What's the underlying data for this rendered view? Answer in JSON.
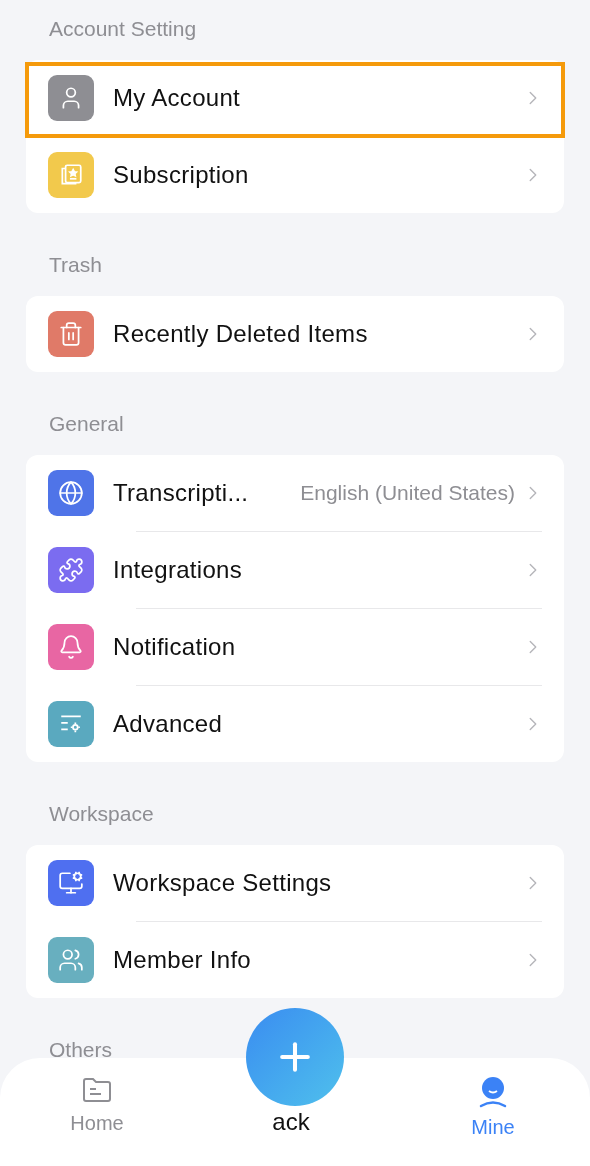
{
  "sections": [
    {
      "title": "Account Setting",
      "items": [
        {
          "label": "My Account",
          "color": "#8e8e93",
          "highlighted": true
        },
        {
          "label": "Subscription",
          "color": "#f2c94c",
          "highlighted": false
        }
      ]
    },
    {
      "title": "Trash",
      "items": [
        {
          "label": "Recently Deleted Items",
          "color": "#e07a68",
          "highlighted": false
        }
      ]
    },
    {
      "title": "General",
      "items": [
        {
          "label": "Transcripti...",
          "value": "English (United States)",
          "color": "#4f74e8",
          "highlighted": false
        },
        {
          "label": "Integrations",
          "color": "#7b6cf0",
          "highlighted": false
        },
        {
          "label": "Notification",
          "color": "#e866a3",
          "highlighted": false
        },
        {
          "label": "Advanced",
          "color": "#5aa9bf",
          "highlighted": false
        }
      ]
    },
    {
      "title": "Workspace",
      "items": [
        {
          "label": "Workspace Settings",
          "color": "#4f6ff0",
          "highlighted": false
        },
        {
          "label": "Member Info",
          "color": "#68afbf",
          "highlighted": false
        }
      ]
    },
    {
      "title": "Others"
    }
  ],
  "tabbar": {
    "tabs": [
      {
        "label": "Home",
        "selected": false
      },
      {
        "label": "ack",
        "selected": false
      },
      {
        "label": "Mine",
        "selected": true
      }
    ]
  }
}
